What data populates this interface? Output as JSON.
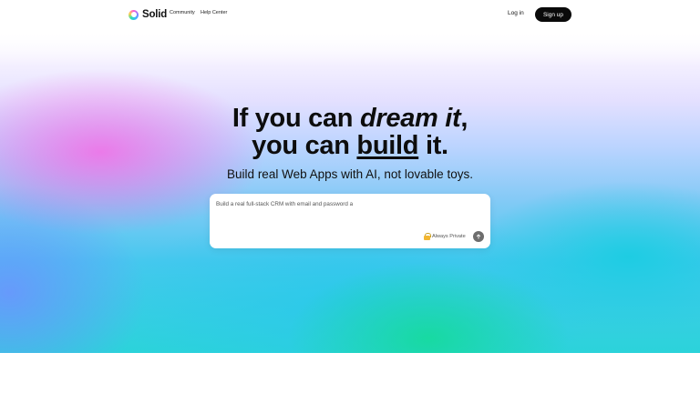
{
  "header": {
    "logo_text": "Solid",
    "nav": {
      "community": "Community",
      "help_center": "Help Center"
    },
    "login_label": "Log in",
    "signup_label": "Sign up"
  },
  "hero": {
    "headline_line1_plain": "If you can ",
    "headline_line1_italic": "dream it",
    "headline_line1_end": ",",
    "headline_line2_plain": "you can ",
    "headline_line2_underlined": "build",
    "headline_line2_end": " it.",
    "subheadline": "Build real Web Apps with AI, not lovable toys."
  },
  "prompt": {
    "value": "Build a real full-stack CRM with email and password a",
    "privacy_label": "Always Private"
  },
  "colors": {
    "signup_bg": "#0a0a0a",
    "send_bg": "#6d6d6d",
    "pink_glow": "#f26ee6",
    "teal_glow": "#14dc96",
    "cyan_glow": "#19cde1"
  },
  "icons": [
    "logo-ring-icon",
    "lock-icon",
    "arrow-up-icon"
  ]
}
